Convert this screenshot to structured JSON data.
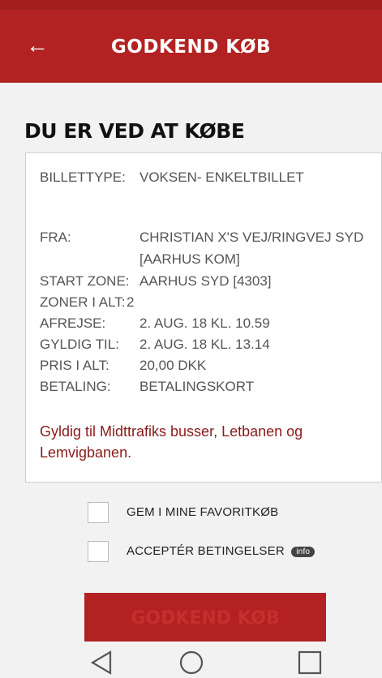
{
  "appbar": {
    "title": "GODKEND KØB"
  },
  "heading": "DU ER VED AT KØBE",
  "ticket": {
    "rows": [
      {
        "label": "BILLETTYPE:",
        "value": "VOKSEN- ENKELTBILLET"
      },
      {
        "label": "FRA:",
        "value": "CHRISTIAN X'S VEJ/RINGVEJ SYD",
        "value2": "[AARHUS KOM]"
      },
      {
        "label": "START ZONE:",
        "value": "AARHUS SYD [4303]"
      },
      {
        "label": "ZONER I ALT:",
        "value": "2"
      },
      {
        "label": "AFREJSE:",
        "value": "2. AUG. 18 KL. 10.59"
      },
      {
        "label": "GYLDIG TIL:",
        "value": "2. AUG. 18 KL. 13.14"
      },
      {
        "label": "PRIS I ALT:",
        "value": "20,00 DKK"
      },
      {
        "label": "BETALING:",
        "value": "BETALINGSKORT"
      }
    ],
    "notice": "Gyldig til Midttrafiks busser, Letbanen og Lemvigbanen."
  },
  "options": {
    "favorite_label": "GEM I MINE FAVORITKØB",
    "terms_label": "ACCEPTÉR BETINGELSER",
    "info_badge": "info"
  },
  "approve_button": "GODKEND KØB",
  "colors": {
    "brand": "#b22222",
    "notice": "#8b1a1a"
  }
}
